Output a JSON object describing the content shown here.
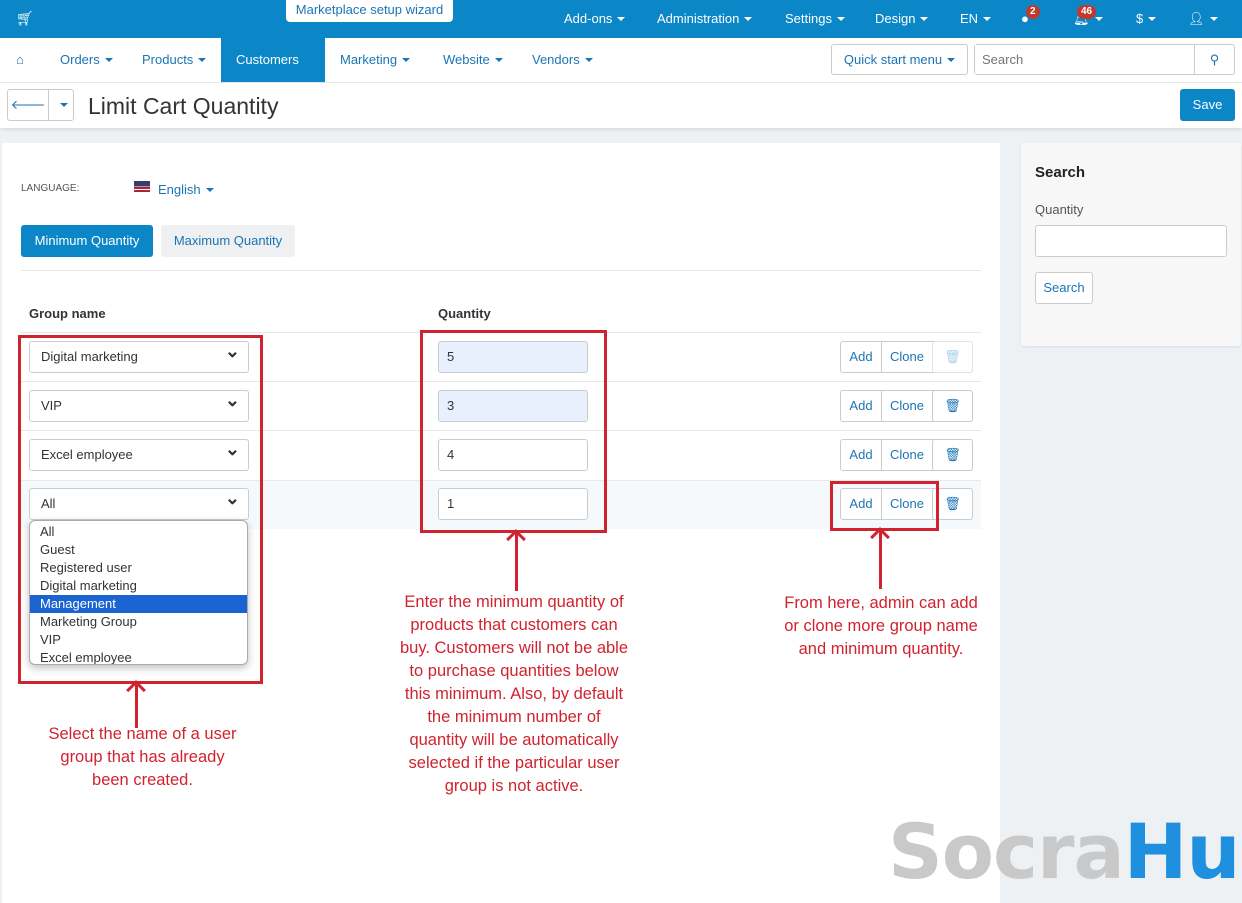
{
  "topbar": {
    "wizard": "Marketplace setup wizard",
    "items": [
      "Add-ons",
      "Administration",
      "Settings",
      "Design",
      "EN"
    ],
    "help_badge": "2",
    "notif_badge": "46",
    "currency": "$"
  },
  "nav": {
    "items": [
      "Orders",
      "Products",
      "Customers",
      "Marketing",
      "Website",
      "Vendors"
    ],
    "active": "Customers",
    "quick_start": "Quick start menu",
    "search_placeholder": "Search"
  },
  "page": {
    "title": "Limit Cart Quantity",
    "save": "Save"
  },
  "language": {
    "label": "LANGUAGE:",
    "value": "English"
  },
  "tabs": [
    {
      "label": "Minimum Quantity",
      "active": true
    },
    {
      "label": "Maximum Quantity",
      "active": false
    }
  ],
  "table": {
    "headers": {
      "group": "Group name",
      "quantity": "Quantity"
    },
    "rows": [
      {
        "group": "Digital marketing",
        "quantity": "5"
      },
      {
        "group": "VIP",
        "quantity": "3"
      },
      {
        "group": "Excel employee",
        "quantity": "4"
      },
      {
        "group": "All",
        "quantity": "1"
      }
    ],
    "add": "Add",
    "clone": "Clone"
  },
  "dropdown": {
    "options": [
      "All",
      "Guest",
      "Registered user",
      "Digital marketing",
      "Management",
      "Marketing Group",
      "VIP",
      "Excel employee"
    ],
    "highlighted": "Management"
  },
  "sidebar": {
    "title": "Search",
    "quantity_label": "Quantity",
    "search_button": "Search"
  },
  "annotations": {
    "group": "Select the name of a user group that has already been created.",
    "quantity": "Enter the minimum quantity of products that customers can buy. Customers will not be able to purchase quantities below this minimum. Also, by default the minimum number of quantity will be automatically selected if the particular user group is not active.",
    "buttons": "From here, admin can add or clone more group name and minimum quantity."
  },
  "watermark": {
    "part1": "Socra",
    "part2": "Hub"
  },
  "colors": {
    "primary": "#0b87c8",
    "annotation": "#d0232f"
  }
}
